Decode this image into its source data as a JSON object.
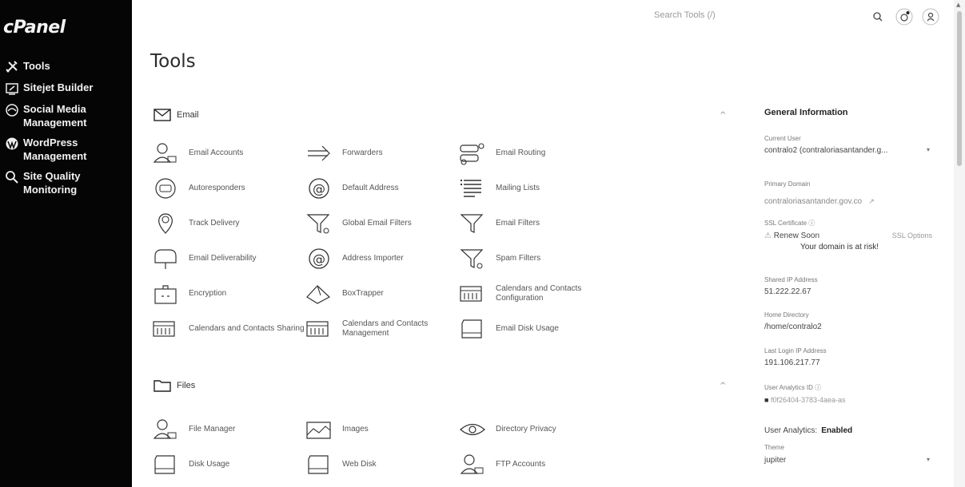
{
  "sidebar": {
    "logo": "cPanel",
    "items": [
      {
        "label": "Tools",
        "icon": "tools-icon"
      },
      {
        "label": "Sitejet Builder",
        "icon": "sitejet-icon"
      },
      {
        "label": "Social Media Management",
        "icon": "social-media-icon"
      },
      {
        "label": "WordPress Management",
        "icon": "wordpress-icon"
      },
      {
        "label": "Site Quality Monitoring",
        "icon": "site-quality-icon"
      }
    ]
  },
  "header": {
    "search_placeholder": "Search Tools (/)",
    "icons": [
      "search-icon",
      "notifications-icon",
      "user-icon"
    ]
  },
  "page_title": "Tools",
  "sections": {
    "email": {
      "label": "Email",
      "collapse_glyph": "^",
      "tools": [
        {
          "label": "Email Accounts",
          "icon": "email-accounts-icon"
        },
        {
          "label": "Forwarders",
          "icon": "forwarders-icon"
        },
        {
          "label": "Email Routing",
          "icon": "email-routing-icon"
        },
        {
          "label": "Autoresponders",
          "icon": "autoresponders-icon"
        },
        {
          "label": "Default Address",
          "icon": "default-address-icon"
        },
        {
          "label": "Mailing Lists",
          "icon": "mailing-lists-icon"
        },
        {
          "label": "Track Delivery",
          "icon": "track-delivery-icon"
        },
        {
          "label": "Global Email Filters",
          "icon": "global-email-filters-icon"
        },
        {
          "label": "Email Filters",
          "icon": "email-filters-icon"
        },
        {
          "label": "Email Deliverability",
          "icon": "email-deliverability-icon"
        },
        {
          "label": "Address Importer",
          "icon": "address-importer-icon"
        },
        {
          "label": "Spam Filters",
          "icon": "spam-filters-icon"
        },
        {
          "label": "Encryption",
          "icon": "encryption-icon"
        },
        {
          "label": "BoxTrapper",
          "icon": "boxtrapper-icon"
        },
        {
          "label": "Calendars and Contacts Configuration",
          "icon": "calendar-config-icon"
        },
        {
          "label": "Calendars and Contacts Sharing",
          "icon": "calendar-sharing-icon"
        },
        {
          "label": "Calendars and Contacts Management",
          "icon": "calendar-management-icon"
        },
        {
          "label": "Email Disk Usage",
          "icon": "email-disk-usage-icon"
        }
      ]
    },
    "files": {
      "label": "Files",
      "collapse_glyph": "^",
      "tools": [
        {
          "label": "File Manager",
          "icon": "file-manager-icon"
        },
        {
          "label": "Images",
          "icon": "images-icon"
        },
        {
          "label": "Directory Privacy",
          "icon": "directory-privacy-icon"
        },
        {
          "label": "Disk Usage",
          "icon": "disk-usage-icon"
        },
        {
          "label": "Web Disk",
          "icon": "web-disk-icon"
        },
        {
          "label": "FTP Accounts",
          "icon": "ftp-accounts-icon"
        }
      ]
    }
  },
  "general_info": {
    "title": "General Information",
    "current_user_label": "Current User",
    "current_user_value": "contralo2 (contraloriasantander.g...",
    "primary_domain_label": "Primary Domain",
    "primary_domain_value": "contraloriasantander.gov.co",
    "ssl_label": "SSL Certificate",
    "ssl_status": "Renew Soon",
    "ssl_options": "SSL Options",
    "ssl_warning": "Your domain is at risk!",
    "shared_ip_label": "Shared IP Address",
    "shared_ip_value": "51.222.22.67",
    "home_dir_label": "Home Directory",
    "home_dir_value": "/home/contralo2",
    "last_login_label": "Last Login IP Address",
    "last_login_value": "191.106.217.77",
    "analytics_id_label": "User Analytics ID",
    "analytics_id_value": "f0f26404-3783-4aea-as",
    "analytics_label": "User Analytics:",
    "analytics_status": "Enabled",
    "theme_label": "Theme",
    "theme_value": "jupiter"
  }
}
